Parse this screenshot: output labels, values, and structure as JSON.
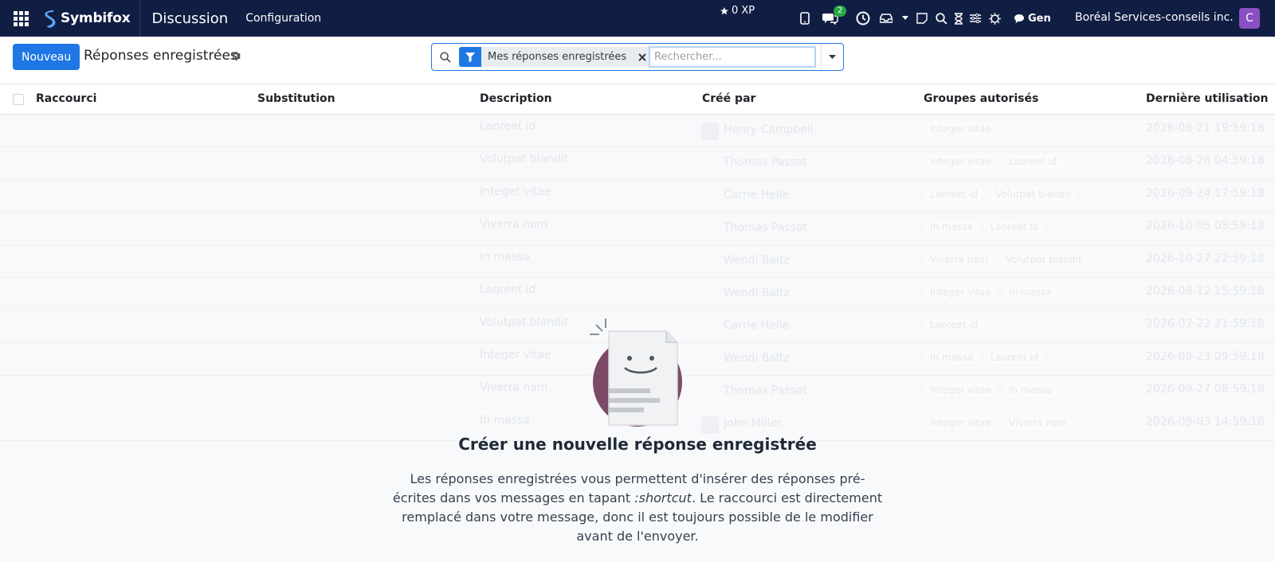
{
  "topbar": {
    "brand": "Symbifox",
    "app_title": "Discussion",
    "nav_configuration": "Configuration",
    "xp": "0 XP",
    "messages_badge": "2",
    "gen_label": "Gen",
    "company": "Boréal Services-conseils inc.",
    "avatar_letter": "C",
    "avatar_color": "#8a4fc2"
  },
  "control": {
    "new_button": "Nouveau",
    "page_title": "Réponses enregistrées",
    "facet_label": "Mes réponses enregistrées",
    "search_placeholder": "Rechercher..."
  },
  "list": {
    "columns": [
      "Raccourci",
      "Substitution",
      "Description",
      "Créé par",
      "Groupes autorisés",
      "Dernière utilisation"
    ],
    "rows": [
      {
        "description": "Laoreet id",
        "created_by": "Henry Campbell",
        "groups": [
          "Integer vitae"
        ],
        "last_used": "2026-08-21 19:59:18"
      },
      {
        "description": "Volutpat blandit",
        "created_by": "Thomas Passot",
        "groups": [
          "Integer vitae",
          "Laoreet id"
        ],
        "last_used": "2026-08-28 04:59:18"
      },
      {
        "description": "Integer vitae",
        "created_by": "Carrie Helle",
        "groups": [
          "Laoreet id",
          "Volutpat blandit"
        ],
        "last_used": "2026-09-24 17:59:18"
      },
      {
        "description": "Viverra nam",
        "created_by": "Thomas Passot",
        "groups": [
          "In massa",
          "Laoreet id"
        ],
        "last_used": "2026-10-05 05:59:18"
      },
      {
        "description": "In massa",
        "created_by": "Wendi Baltz",
        "groups": [
          "Viverra nam",
          "Volutpat blandit"
        ],
        "last_used": "2026-10-27 22:59:18"
      },
      {
        "description": "Laoreet id",
        "created_by": "Wendi Baltz",
        "groups": [
          "Integer vitae",
          "In massa"
        ],
        "last_used": "2026-08-12 15:59:18"
      },
      {
        "description": "Volutpat blandit",
        "created_by": "Carrie Helle",
        "groups": [
          "Laoreet id"
        ],
        "last_used": "2026-07-22 21:59:18"
      },
      {
        "description": "Integer vitae",
        "created_by": "Wendi Baltz",
        "groups": [
          "In massa",
          "Laoreet id"
        ],
        "last_used": "2026-08-23 09:59:18"
      },
      {
        "description": "Viverra nam",
        "created_by": "Thomas Passot",
        "groups": [
          "Integer vitae",
          "In massa"
        ],
        "last_used": "2026-09-27 08:59:18"
      },
      {
        "description": "In massa",
        "created_by": "John Miller",
        "groups": [
          "Integer vitae",
          "Viverra nam"
        ],
        "last_used": "2026-09-03 14:59:18"
      }
    ]
  },
  "empty_state": {
    "title": "Créer une nouvelle réponse enregistrée",
    "text_before": "Les réponses enregistrées vous permettent d'insérer des réponses pré-écrites dans vos messages en tapant ",
    "text_shortcut": ":shortcut",
    "text_after": ". Le raccourci est directement remplacé dans votre message, donc il est toujours possible de le modifier avant de l'envoyer."
  }
}
